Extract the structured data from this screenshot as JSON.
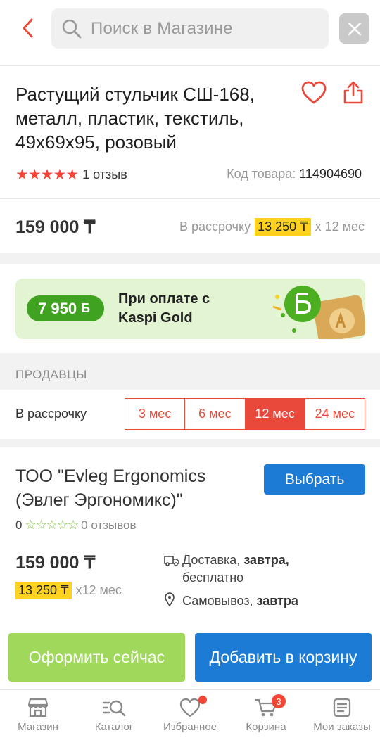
{
  "search": {
    "placeholder": "Поиск в Магазине"
  },
  "product": {
    "title": "Растущий стульчик СШ-168, металл, пластик, текстиль, 49х69х95, розовый",
    "stars": "★★★★★",
    "reviews": "1 отзыв",
    "sku_label": "Код товара:",
    "sku": "114904690",
    "price": "159 000 ₸",
    "installment_label": "В рассрочку",
    "installment_amount": "13 250 ₸",
    "installment_term": "x 12 мес"
  },
  "kaspi_gold": {
    "bonus": "7 950",
    "bonus_symbol": "Б",
    "text_line1": "При оплате с",
    "text_line2": "Kaspi Gold"
  },
  "sellers": {
    "header": "ПРОДАВЦЫ",
    "installment_label": "В рассрочку",
    "tabs": [
      {
        "label": "3 мес",
        "active": false
      },
      {
        "label": "6 мес",
        "active": false
      },
      {
        "label": "12 мес",
        "active": true
      },
      {
        "label": "24 мес",
        "active": false
      }
    ],
    "seller": {
      "name": "ТОО \"Evleg Ergonomics (Эвлег Эргономикс)\"",
      "choose_label": "Выбрать",
      "rating": "0",
      "stars": "☆☆☆☆☆",
      "reviews": "0 отзывов",
      "price": "159 000 ₸",
      "installment_amount": "13 250 ₸",
      "installment_term": "x12 мес",
      "delivery_label": "Доставка,",
      "delivery_when": "завтра,",
      "delivery_cost": "бесплатно",
      "pickup_label": "Самовывоз,",
      "pickup_when": "завтра"
    }
  },
  "actions": {
    "buy_now": "Оформить сейчас",
    "add_to_cart": "Добавить в корзину"
  },
  "nav": {
    "items": [
      {
        "label": "Магазин",
        "icon": "shop-icon"
      },
      {
        "label": "Каталог",
        "icon": "catalog-icon"
      },
      {
        "label": "Избранное",
        "icon": "heart-icon"
      },
      {
        "label": "Корзина",
        "icon": "cart-icon",
        "badge": "3"
      },
      {
        "label": "Мои заказы",
        "icon": "orders-icon"
      }
    ]
  },
  "colors": {
    "accent_red": "#e8493b",
    "kaspi_blue": "#1c7cd5",
    "kaspi_green": "#3fa220",
    "highlight_yellow": "#ffd21f"
  }
}
